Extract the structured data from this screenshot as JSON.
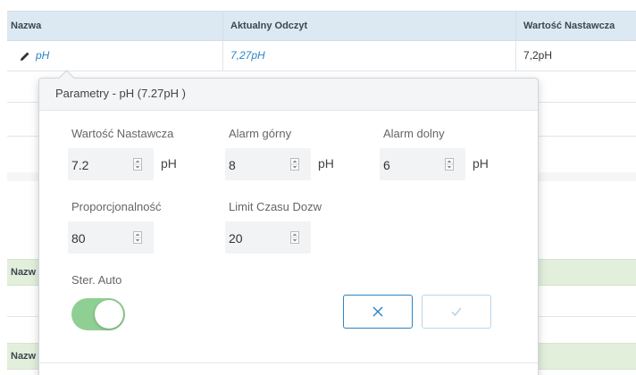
{
  "table": {
    "headers": [
      "Nazwa",
      "Aktualny Odczyt",
      "Wartość Nastawcza"
    ],
    "row": {
      "name": "pH",
      "reading": "7,27pH",
      "setpoint": "7,2pH"
    }
  },
  "groups": [
    {
      "header": "Nazw"
    },
    {
      "header": "Nazw"
    }
  ],
  "popover": {
    "title": "Parametry - pH (7.27pH )",
    "fields": [
      {
        "label": "Wartość Nastawcza",
        "value": "7.2",
        "unit": "pH"
      },
      {
        "label": "Alarm górny",
        "value": "8",
        "unit": "pH"
      },
      {
        "label": "Alarm dolny",
        "value": "6",
        "unit": "pH"
      },
      {
        "label": "Proporcjonalność",
        "value": "80",
        "unit": ""
      },
      {
        "label": "Limit Czasu Dozw",
        "value": "20",
        "unit": ""
      }
    ],
    "auto": {
      "label": "Ster. Auto",
      "on": true
    }
  },
  "colors": {
    "accent": "#2a84c6",
    "header_bg": "#dde9f2",
    "group_bg": "#e2efdb",
    "toggle_on": "#8fcf93"
  },
  "icons": {
    "edit": "pencil-icon",
    "spinner": "spinner-arrows-icon",
    "cancel": "close-icon",
    "confirm": "check-icon"
  }
}
